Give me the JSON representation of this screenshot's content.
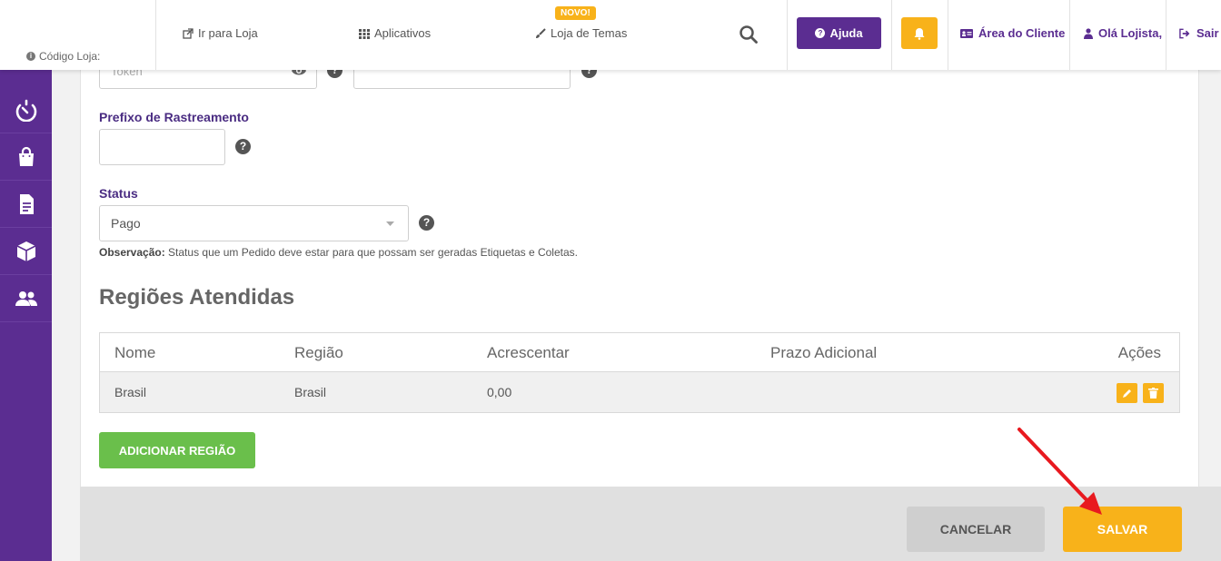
{
  "header": {
    "store_code_label": "Código Loja:",
    "go_to_store": "Ir para Loja",
    "apps": "Aplicativos",
    "theme_store": "Loja de Temas",
    "new_badge": "NOVO!",
    "help": "Ajuda",
    "client_area": "Área do Cliente",
    "greeting": "Olá Lojista,",
    "logout": "Sair"
  },
  "sidebar": {
    "items": [
      {
        "icon": "speedometer-icon"
      },
      {
        "icon": "shopping-bag-icon"
      },
      {
        "icon": "document-icon"
      },
      {
        "icon": "box-icon"
      },
      {
        "icon": "users-icon"
      }
    ]
  },
  "form": {
    "token_placeholder": "Token",
    "tracking_prefix_label": "Prefixo de Rastreamento",
    "tracking_prefix_value": "",
    "status_label": "Status",
    "status_selected": "Pago",
    "obs_label": "Observação:",
    "obs_text": "Status que um Pedido deve estar para que possam ser geradas Etiquetas e Coletas."
  },
  "regions": {
    "title": "Regiões Atendidas",
    "columns": [
      "Nome",
      "Região",
      "Acrescentar",
      "Prazo Adicional",
      "Ações"
    ],
    "rows": [
      {
        "nome": "Brasil",
        "regiao": "Brasil",
        "acrescentar": "0,00",
        "prazo": ""
      }
    ],
    "add_button": "ADICIONAR REGIÃO"
  },
  "actions": {
    "cancel": "CANCELAR",
    "save": "SALVAR"
  },
  "colors": {
    "brand_purple": "#5b2d91",
    "accent_yellow": "#f8b21a",
    "success_green": "#6abf4b",
    "annotation_red": "#e8191f"
  }
}
